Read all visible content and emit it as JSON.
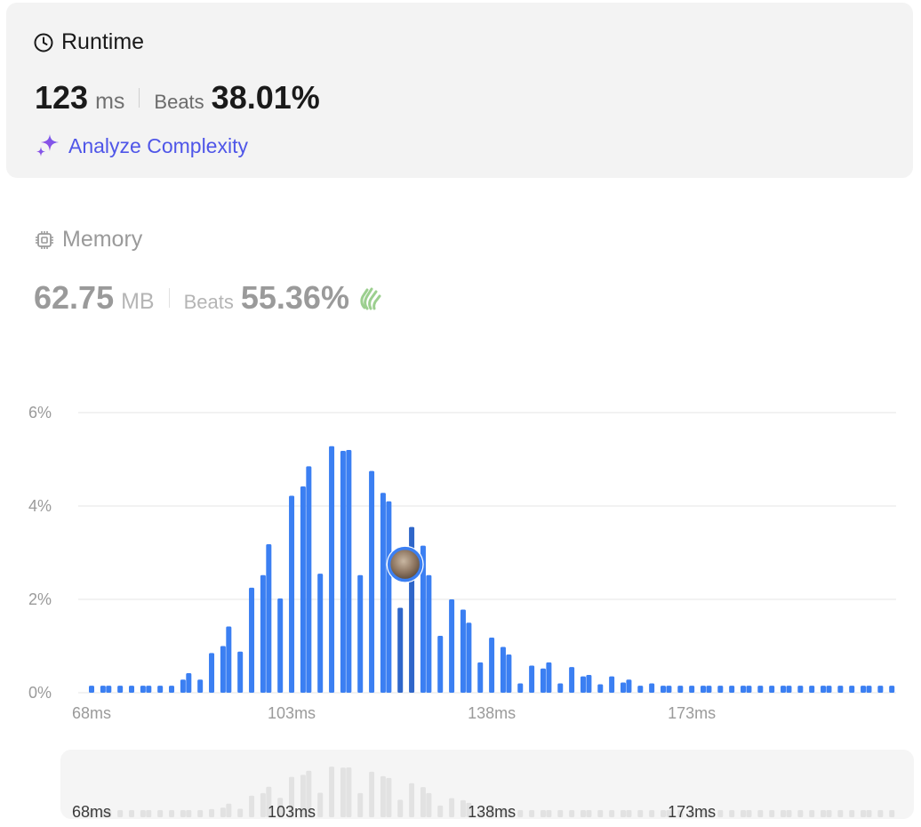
{
  "runtime": {
    "title": "Runtime",
    "value": "123",
    "unit": "ms",
    "beats_label": "Beats",
    "beats_value": "38.01%",
    "analyze_label": "Analyze Complexity"
  },
  "memory": {
    "title": "Memory",
    "value": "62.75",
    "unit": "MB",
    "beats_label": "Beats",
    "beats_value": "55.36%"
  },
  "colors": {
    "bar": "#3b7ff2",
    "bar_highlight": "#2f66c9",
    "grid": "#e6e6e6",
    "accent": "#4f56e8"
  },
  "chart_data": {
    "type": "bar",
    "xlabel": "",
    "ylabel": "",
    "ylim": [
      0,
      6
    ],
    "y_ticks": [
      "0%",
      "2%",
      "4%",
      "6%"
    ],
    "x_ticks": [
      "68ms",
      "103ms",
      "138ms",
      "173ms"
    ],
    "x_tick_values": [
      68,
      103,
      138,
      173
    ],
    "grid": true,
    "highlight_x": 123,
    "x": [
      68,
      70,
      71,
      73,
      75,
      77,
      78,
      80,
      82,
      84,
      85,
      87,
      89,
      91,
      92,
      94,
      96,
      98,
      99,
      101,
      103,
      105,
      106,
      108,
      110,
      112,
      113,
      115,
      117,
      119,
      120,
      122,
      124,
      126,
      127,
      129,
      131,
      133,
      134,
      136,
      138,
      140,
      141,
      143,
      145,
      147,
      148,
      150,
      152,
      154,
      155,
      157,
      159,
      161,
      162,
      164,
      166,
      168,
      169,
      171,
      173,
      175,
      176,
      178,
      180,
      182,
      183,
      185,
      187,
      189,
      190,
      192,
      194,
      196,
      197,
      199,
      201,
      203,
      204,
      206,
      208
    ],
    "values": [
      0.15,
      0.15,
      0.15,
      0.15,
      0.15,
      0.15,
      0.15,
      0.15,
      0.15,
      0.28,
      0.42,
      0.28,
      0.85,
      1.0,
      1.42,
      0.88,
      2.25,
      2.52,
      3.18,
      2.02,
      4.22,
      4.42,
      4.85,
      2.55,
      5.28,
      5.18,
      5.2,
      2.52,
      4.75,
      4.28,
      4.1,
      1.82,
      3.55,
      3.15,
      2.52,
      1.22,
      2.0,
      1.78,
      1.5,
      0.65,
      1.18,
      0.98,
      0.82,
      0.2,
      0.58,
      0.52,
      0.65,
      0.2,
      0.55,
      0.35,
      0.38,
      0.18,
      0.35,
      0.22,
      0.28,
      0.15,
      0.2,
      0.15,
      0.15,
      0.15,
      0.15,
      0.15,
      0.15,
      0.15,
      0.15,
      0.15,
      0.15,
      0.15,
      0.15,
      0.15,
      0.15,
      0.15,
      0.15,
      0.15,
      0.15,
      0.15,
      0.15,
      0.15,
      0.15,
      0.15,
      0.15
    ]
  }
}
